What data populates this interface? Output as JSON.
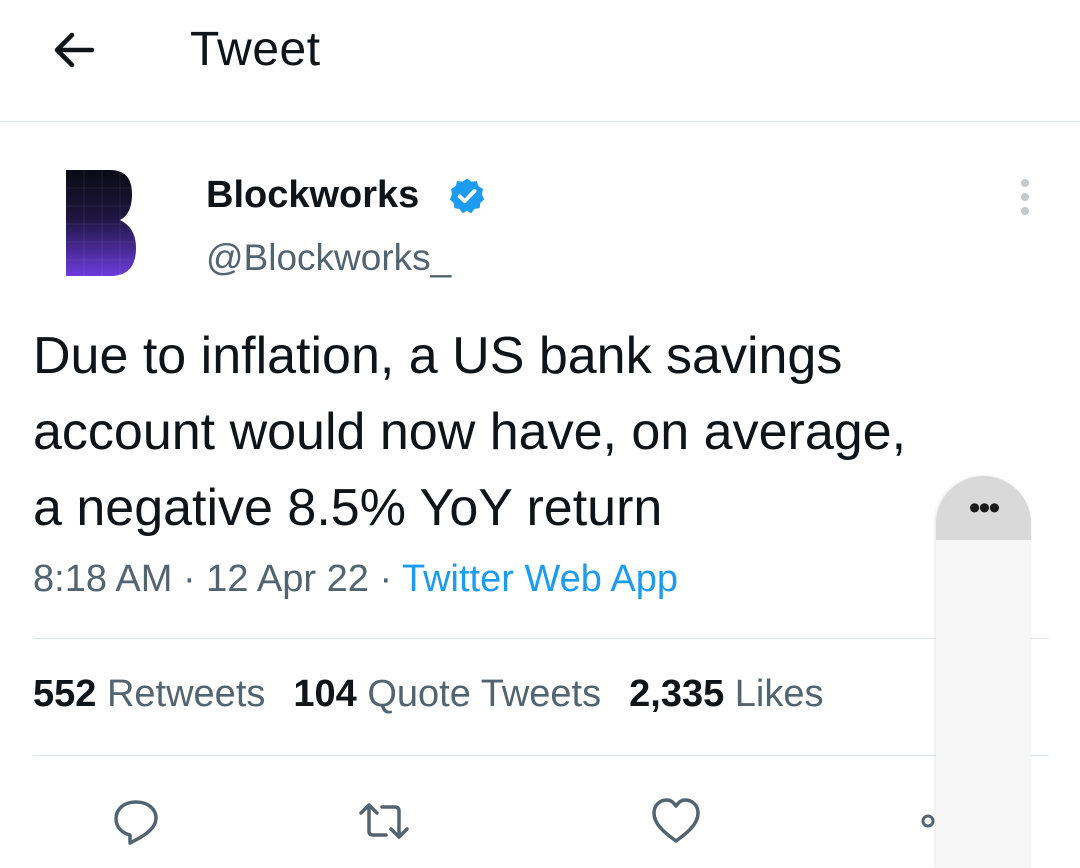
{
  "header": {
    "title": "Tweet"
  },
  "author": {
    "name": "Blockworks",
    "handle": "@Blockworks_",
    "verified": true
  },
  "tweet": {
    "lines": [
      "Due to inflation, a US bank savings",
      "account would now have, on average,",
      "a negative 8.5% YoY return"
    ],
    "time": "8:18 AM",
    "date": "12 Apr 22",
    "source": "Twitter Web App",
    "separator": " · "
  },
  "stats": {
    "retweets": {
      "count": "552",
      "label": "Retweets"
    },
    "quotes": {
      "count": "104",
      "label": "Quote Tweets"
    },
    "likes": {
      "count": "2,335",
      "label": "Likes"
    }
  },
  "overlay": {
    "label": "•••"
  },
  "colors": {
    "accent": "#1d9bf0",
    "text": "#0f1419",
    "secondary": "#536471",
    "divider": "#e1e6ea",
    "avatar_purple": "#6c3bdc"
  },
  "icons": {
    "back": "arrow-left-icon",
    "verified": "verified-badge-icon",
    "more": "more-vertical-icon",
    "reply": "reply-icon",
    "retweet": "retweet-icon",
    "like": "heart-icon",
    "share": "share-icon"
  }
}
